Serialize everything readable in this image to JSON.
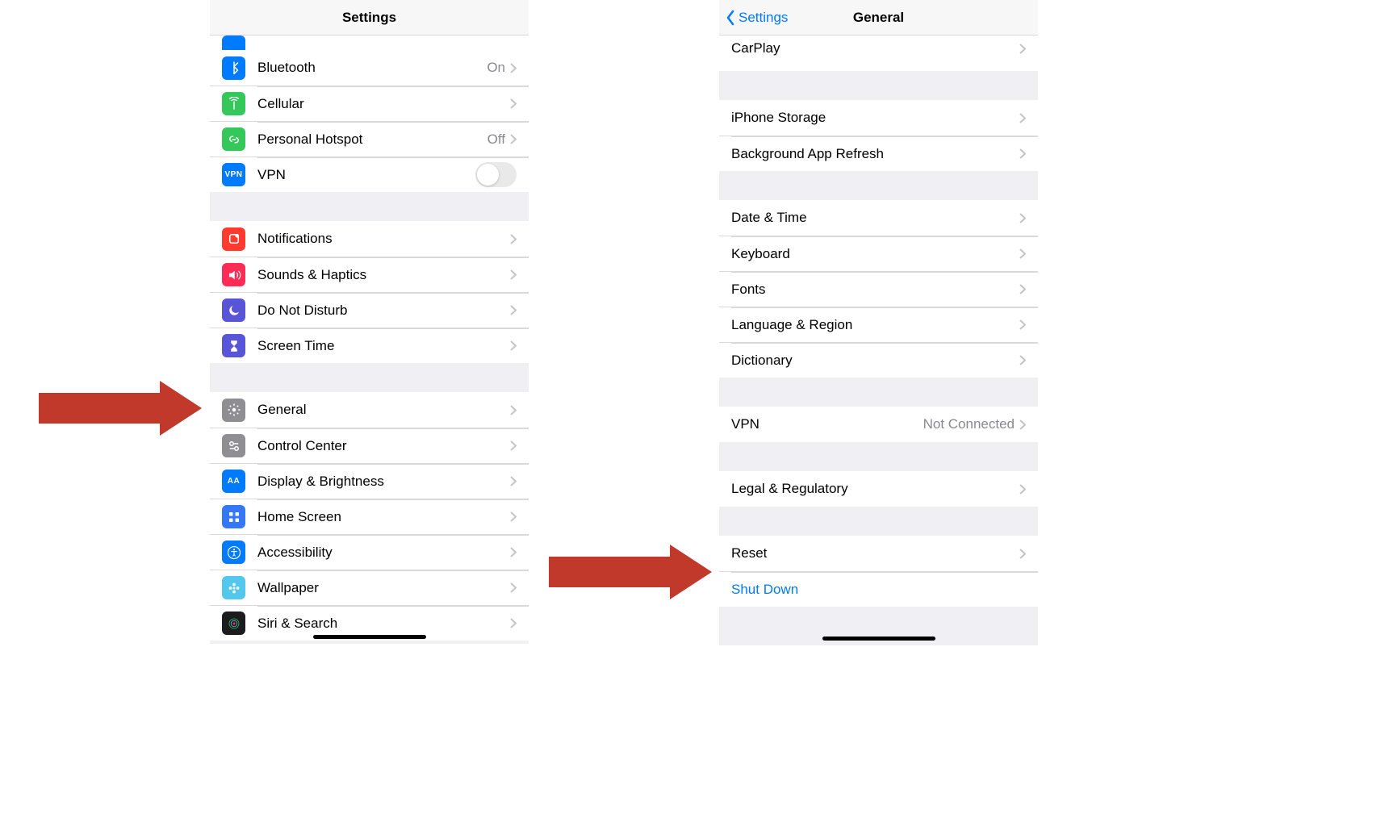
{
  "left": {
    "title": "Settings",
    "groups": [
      {
        "rows": [
          {
            "id": "bluetooth",
            "icon": "bluetooth-icon",
            "bg": "#007aff",
            "label": "Bluetooth",
            "detail": "On",
            "disclosure": true
          },
          {
            "id": "cellular",
            "icon": "antenna-icon",
            "bg": "#34c759",
            "label": "Cellular",
            "disclosure": true
          },
          {
            "id": "hotspot",
            "icon": "link-icon",
            "bg": "#34c759",
            "label": "Personal Hotspot",
            "detail": "Off",
            "disclosure": true
          },
          {
            "id": "vpn",
            "icon": "vpn-icon",
            "bg": "#007aff",
            "icon_text": "VPN",
            "label": "VPN",
            "toggle": false
          }
        ]
      },
      {
        "rows": [
          {
            "id": "notifications",
            "icon": "notifications-icon",
            "bg": "#ff3b30",
            "label": "Notifications",
            "disclosure": true
          },
          {
            "id": "sounds",
            "icon": "speaker-icon",
            "bg": "#ff2d55",
            "label": "Sounds & Haptics",
            "disclosure": true
          },
          {
            "id": "dnd",
            "icon": "moon-icon",
            "bg": "#5856d6",
            "label": "Do Not Disturb",
            "disclosure": true
          },
          {
            "id": "screentime",
            "icon": "hourglass-icon",
            "bg": "#5856d6",
            "label": "Screen Time",
            "disclosure": true
          }
        ]
      },
      {
        "rows": [
          {
            "id": "general",
            "icon": "gear-icon",
            "bg": "#8e8e93",
            "label": "General",
            "disclosure": true
          },
          {
            "id": "control-center",
            "icon": "switches-icon",
            "bg": "#8e8e93",
            "label": "Control Center",
            "disclosure": true
          },
          {
            "id": "display",
            "icon": "textsize-icon",
            "bg": "#007aff",
            "icon_text": "AA",
            "label": "Display & Brightness",
            "disclosure": true
          },
          {
            "id": "home",
            "icon": "grid-icon",
            "bg": "#3478f6",
            "label": "Home Screen",
            "disclosure": true
          },
          {
            "id": "accessibility",
            "icon": "accessibility-icon",
            "bg": "#007aff",
            "label": "Accessibility",
            "disclosure": true
          },
          {
            "id": "wallpaper",
            "icon": "flower-icon",
            "bg": "#54c7ec",
            "label": "Wallpaper",
            "disclosure": true
          },
          {
            "id": "siri",
            "icon": "siri-icon",
            "bg": "#1c1c1e",
            "label": "Siri & Search",
            "disclosure": true
          }
        ]
      }
    ]
  },
  "right": {
    "title": "General",
    "back_label": "Settings",
    "partial_top_label": "CarPlay",
    "groups": [
      {
        "rows": [
          {
            "id": "storage",
            "label": "iPhone Storage",
            "disclosure": true
          },
          {
            "id": "bgrefresh",
            "label": "Background App Refresh",
            "disclosure": true
          }
        ]
      },
      {
        "rows": [
          {
            "id": "datetime",
            "label": "Date & Time",
            "disclosure": true
          },
          {
            "id": "keyboard",
            "label": "Keyboard",
            "disclosure": true
          },
          {
            "id": "fonts",
            "label": "Fonts",
            "disclosure": true
          },
          {
            "id": "language",
            "label": "Language & Region",
            "disclosure": true
          },
          {
            "id": "dictionary",
            "label": "Dictionary",
            "disclosure": true
          }
        ]
      },
      {
        "rows": [
          {
            "id": "vpn2",
            "label": "VPN",
            "detail": "Not Connected",
            "disclosure": true
          }
        ]
      },
      {
        "rows": [
          {
            "id": "legal",
            "label": "Legal & Regulatory",
            "disclosure": true
          }
        ]
      },
      {
        "rows": [
          {
            "id": "reset",
            "label": "Reset",
            "disclosure": true
          },
          {
            "id": "shutdown",
            "label": "Shut Down",
            "link": true
          }
        ]
      }
    ]
  },
  "colors": {
    "arrow": "#c1392b",
    "link": "#007aff"
  }
}
